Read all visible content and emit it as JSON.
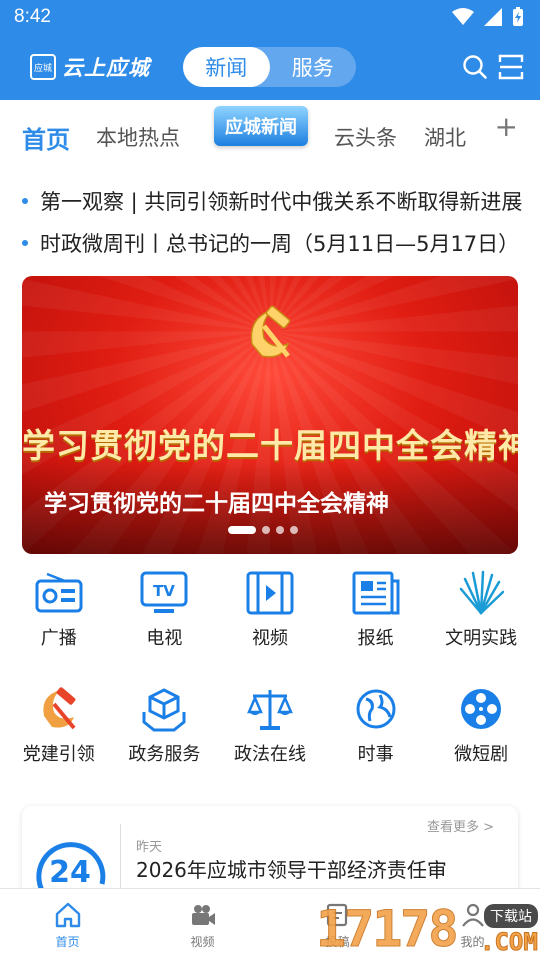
{
  "status_bar": {
    "time": "8:42"
  },
  "header": {
    "logo_badge": "应城",
    "app_name": "云上应城",
    "segments": [
      {
        "label": "新闻",
        "active": true
      },
      {
        "label": "服务",
        "active": false
      }
    ],
    "icons": [
      "search-icon",
      "scan-icon"
    ]
  },
  "tabs": {
    "items": [
      {
        "label": "首页",
        "active": true
      },
      {
        "label": "本地热点",
        "active": false
      },
      {
        "label": "应城新闻",
        "active": false,
        "special": true
      },
      {
        "label": "云头条",
        "active": false
      },
      {
        "label": "湖北",
        "active": false
      }
    ],
    "more": "+"
  },
  "headlines": [
    "第一观察 | 共同引领新时代中俄关系不断取得新进展",
    "时政微周刊丨总书记的一周（5月11日—5月17日）"
  ],
  "banner": {
    "headline": "学习贯彻党的二十届四中全会精神",
    "caption": "学习贯彻党的二十届四中全会精神",
    "slides": 4,
    "active_slide": 1
  },
  "grid": {
    "row1": [
      {
        "label": "广播",
        "icon": "radio-icon"
      },
      {
        "label": "电视",
        "icon": "tv-icon"
      },
      {
        "label": "视频",
        "icon": "film-icon"
      },
      {
        "label": "报纸",
        "icon": "newspaper-icon"
      },
      {
        "label": "文明实践",
        "icon": "fan-icon"
      }
    ],
    "row2": [
      {
        "label": "党建引领",
        "icon": "party-emblem-icon"
      },
      {
        "label": "政务服务",
        "icon": "cube-hands-icon"
      },
      {
        "label": "政法在线",
        "icon": "scales-icon"
      },
      {
        "label": "时事",
        "icon": "globe-icon"
      },
      {
        "label": "微短剧",
        "icon": "film-reel-icon"
      }
    ]
  },
  "card": {
    "more": "查看更多 >",
    "clock_text": "24",
    "time": "昨天",
    "title": "2026年应城市领导干部经济责任审"
  },
  "bottom_nav": [
    {
      "label": "首页",
      "icon": "home-icon",
      "active": true
    },
    {
      "label": "视频",
      "icon": "video-camera-icon",
      "active": false
    },
    {
      "label": "投稿",
      "icon": "edit-icon",
      "active": false
    },
    {
      "label": "我的",
      "icon": "user-icon",
      "active": false
    }
  ],
  "watermark": {
    "number": "17178",
    "tag": "下载站",
    "domain": ".COM"
  },
  "colors": {
    "brand_blue": "#2f8be8",
    "banner_red": "#e01d12",
    "banner_gold": "#ffe9a8"
  }
}
